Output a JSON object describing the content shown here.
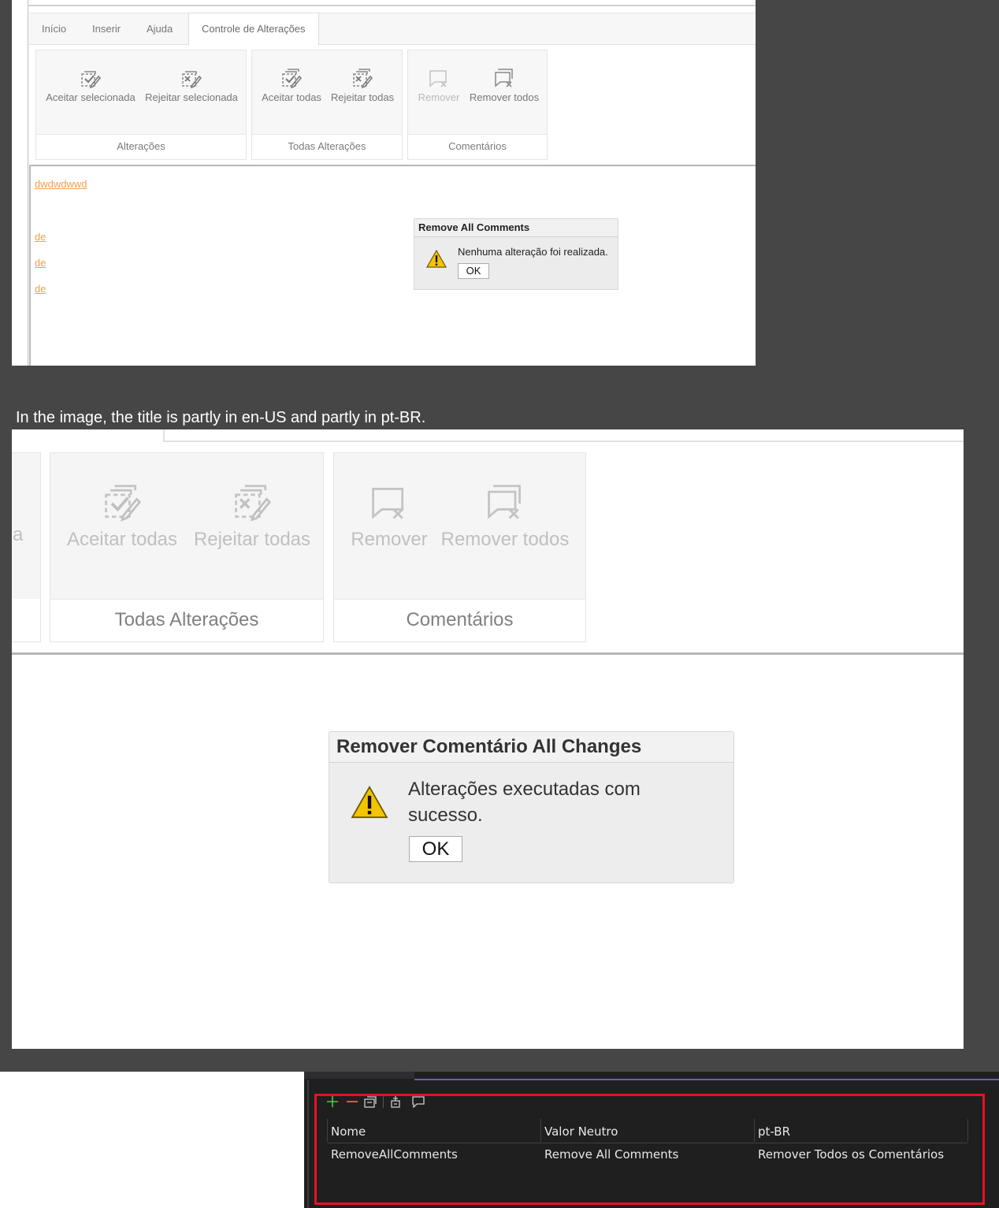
{
  "panel1": {
    "tabs": [
      "Início",
      "Inserir",
      "Ajuda",
      "Controle de Alterações"
    ],
    "groups": {
      "alteracoes": {
        "label": "Alterações",
        "accept": "Aceitar selecionada",
        "reject": "Rejeitar selecionada"
      },
      "todas": {
        "label": "Todas Alterações",
        "accept_all": "Aceitar todas",
        "reject_all": "Rejeitar todas"
      },
      "comentarios": {
        "label": "Comentários",
        "remove": "Remover",
        "remove_all": "Remover todos"
      }
    },
    "doc_lines": [
      "dwdwdwwd",
      "de",
      "de",
      "de"
    ],
    "dialog": {
      "title": "Remove All Comments",
      "message": "Nenhuma alteração foi realizada.",
      "ok": "OK"
    }
  },
  "caption": "In the image, the title is partly in en-US and partly in pt-BR.",
  "panel2": {
    "partial_label": "a",
    "groups": {
      "todas": {
        "label": "Todas Alterações",
        "accept_all": "Aceitar todas",
        "reject_all": "Rejeitar todas"
      },
      "comentarios": {
        "label": "Comentários",
        "remove": "Remover",
        "remove_all": "Remover todos"
      }
    },
    "dialog": {
      "title": "Remover Comentário All Changes",
      "message": "Alterações executadas com sucesso.",
      "ok": "OK"
    }
  },
  "panel3": {
    "toolbar_icons": [
      "add-icon",
      "remove-icon",
      "copy-icon",
      "resource-icon",
      "comment-icon"
    ],
    "columns": [
      "Nome",
      "Valor Neutro",
      "pt-BR"
    ],
    "rows": [
      [
        "RemoveAllComments",
        "Remove All Comments",
        "Remover Todos os Comentários"
      ]
    ]
  }
}
